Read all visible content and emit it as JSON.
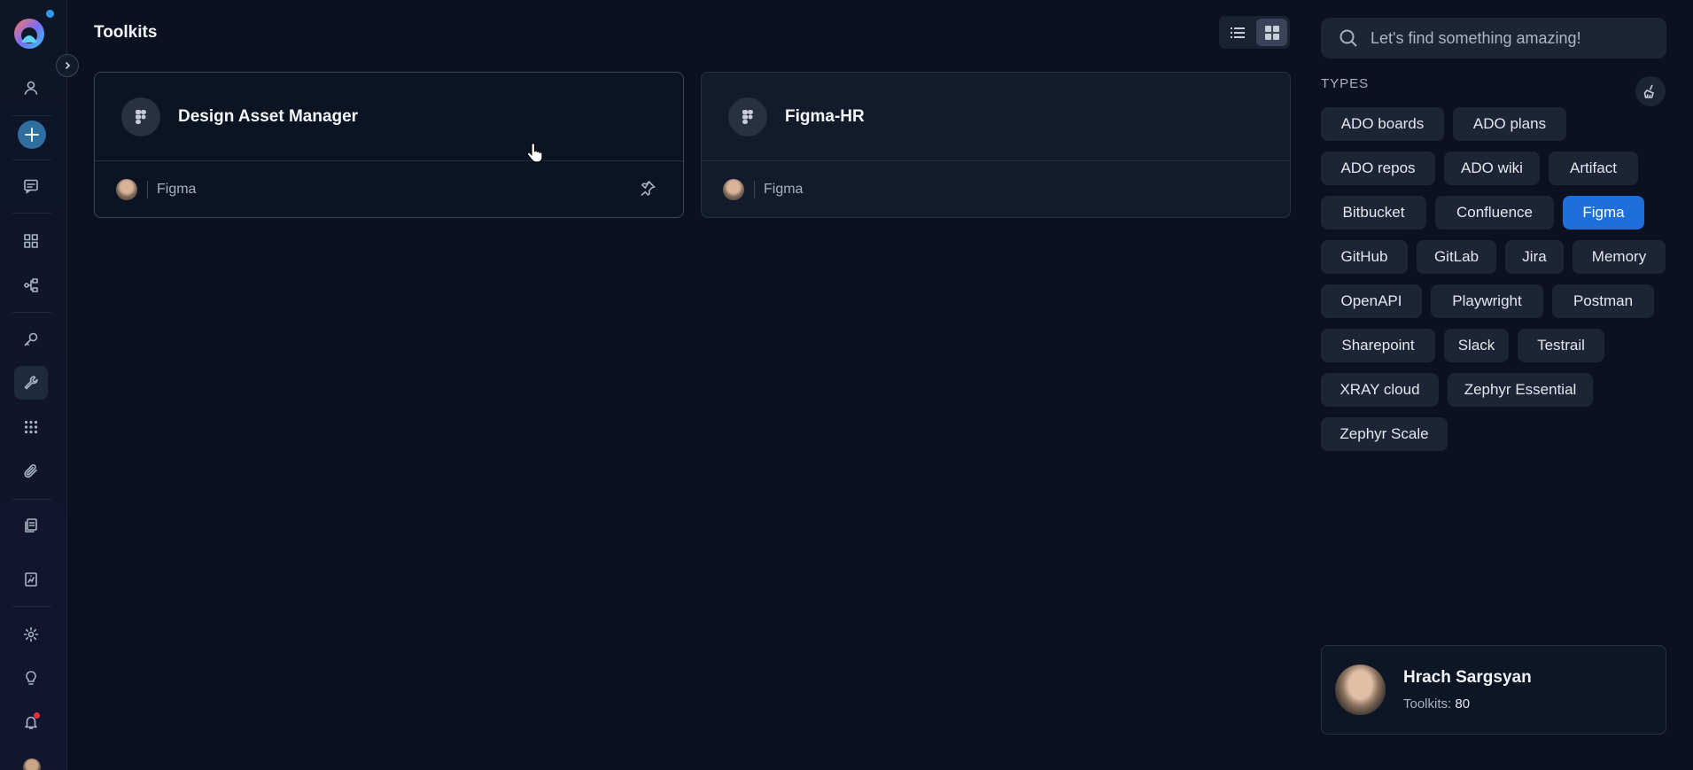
{
  "page_title": "Toolkits",
  "view_toggle": {
    "list_icon": "list-icon",
    "grid_icon": "grid-icon",
    "active": "grid"
  },
  "cards": [
    {
      "title": "Design Asset Manager",
      "type_label": "Figma",
      "icon": "figma-icon",
      "pinnable": true
    },
    {
      "title": "Figma-HR",
      "type_label": "Figma",
      "icon": "figma-icon",
      "pinnable": false
    }
  ],
  "search": {
    "placeholder": "Let's find something amazing!",
    "value": ""
  },
  "types": {
    "label": "TYPES",
    "items": [
      {
        "label": "ADO boards"
      },
      {
        "label": "ADO plans"
      },
      {
        "label": "ADO repos"
      },
      {
        "label": "ADO wiki"
      },
      {
        "label": "Artifact"
      },
      {
        "label": "Bitbucket"
      },
      {
        "label": "Confluence"
      },
      {
        "label": "Figma",
        "selected": true
      },
      {
        "label": "GitHub"
      },
      {
        "label": "GitLab"
      },
      {
        "label": "Jira"
      },
      {
        "label": "Memory"
      },
      {
        "label": "OpenAPI"
      },
      {
        "label": "Playwright"
      },
      {
        "label": "Postman"
      },
      {
        "label": "Sharepoint"
      },
      {
        "label": "Slack"
      },
      {
        "label": "Testrail"
      },
      {
        "label": "XRAY cloud"
      },
      {
        "label": "Zephyr Essential"
      },
      {
        "label": "Zephyr Scale"
      }
    ]
  },
  "user": {
    "name": "Hrach Sargsyan",
    "toolkits_label": "Toolkits:",
    "toolkits_count": "80"
  },
  "colors": {
    "accent": "#1e6fd9",
    "background": "#0b1120",
    "chip": "#1d2435"
  },
  "sidebar_icons": [
    "user-icon",
    "plus-icon",
    "chat-icon",
    "dashboard-icon",
    "flow-icon",
    "key-icon",
    "wrench-icon",
    "apps-icon",
    "paperclip-icon",
    "documents-icon",
    "report-icon",
    "settings-icon",
    "lightbulb-icon",
    "bell-icon"
  ]
}
